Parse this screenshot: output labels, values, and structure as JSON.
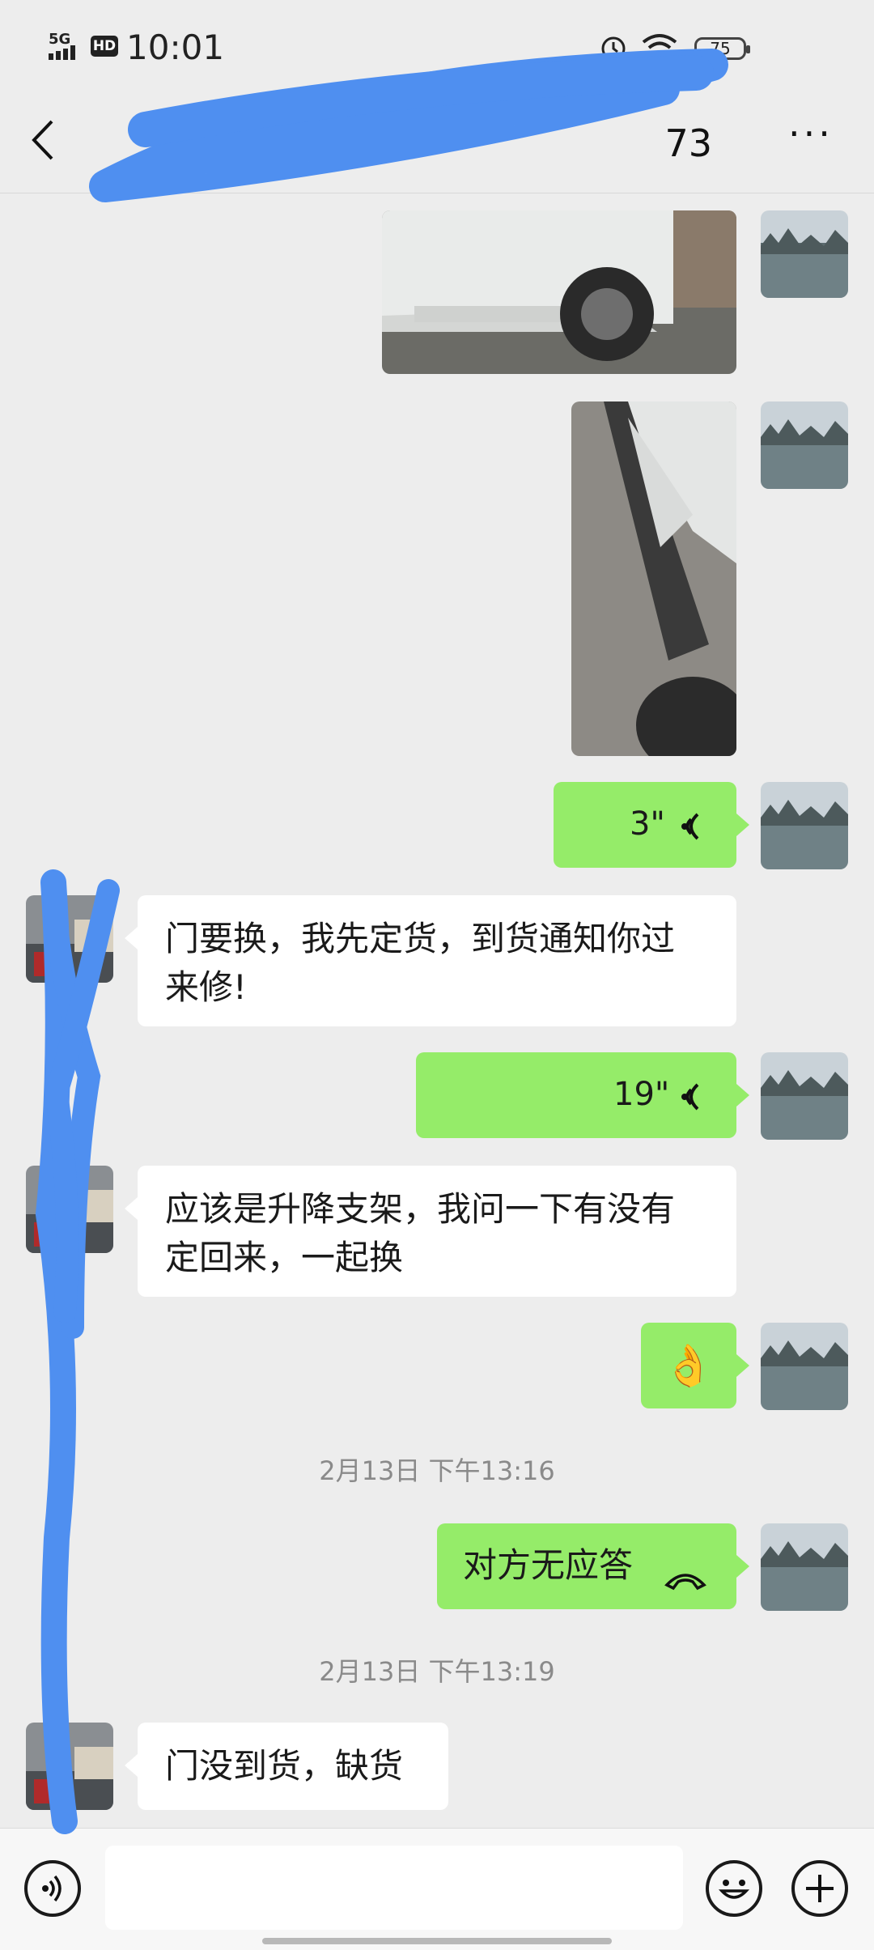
{
  "status_bar": {
    "network": "5G",
    "hd": "HD",
    "time": "10:01",
    "battery": "75"
  },
  "header": {
    "title_visible": "73",
    "more": "···"
  },
  "messages": [
    {
      "type": "image",
      "side": "right",
      "desc": "car-door-photo"
    },
    {
      "type": "image",
      "side": "right",
      "desc": "car-side-photo"
    },
    {
      "type": "voice",
      "side": "right",
      "duration": "3\""
    },
    {
      "type": "text",
      "side": "left",
      "lines": [
        "门要换，我先定货，到货通知你过",
        "来修!"
      ]
    },
    {
      "type": "voice",
      "side": "right",
      "duration": "19\""
    },
    {
      "type": "text",
      "side": "left",
      "lines": [
        "应该是升降支架，我问一下有没有",
        "定回来，一起换"
      ]
    },
    {
      "type": "emoji",
      "side": "right",
      "emoji": "👌"
    },
    {
      "type": "timestamp",
      "text": "2月13日 下午13:16"
    },
    {
      "type": "call",
      "side": "right",
      "text": "对方无应答"
    },
    {
      "type": "timestamp",
      "text": "2月13日 下午13:19"
    },
    {
      "type": "text",
      "side": "left",
      "lines": [
        "门没到货，缺货"
      ]
    }
  ],
  "input_bar": {
    "placeholder": ""
  }
}
